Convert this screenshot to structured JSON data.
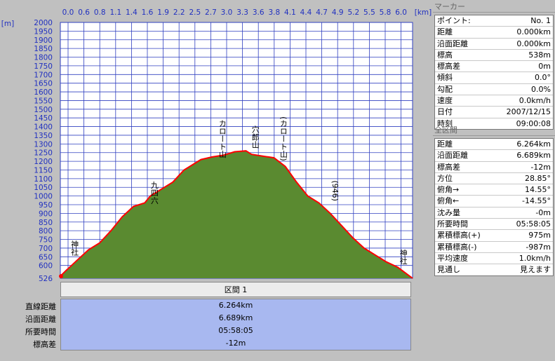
{
  "chart_data": {
    "type": "area",
    "x_unit": "[km]",
    "y_unit": "[m]",
    "x_ticks": [
      "0.0",
      "0.6",
      "0.8",
      "1.1",
      "1.4",
      "1.6",
      "1.9",
      "2.2",
      "2.5",
      "2.7",
      "3.0",
      "3.3",
      "3.6",
      "3.8",
      "4.1",
      "4.4",
      "4.7",
      "4.9",
      "5.2",
      "5.5",
      "5.8",
      "6.0"
    ],
    "y_ticks": [
      "2000",
      "1950",
      "1900",
      "1850",
      "1800",
      "1750",
      "1700",
      "1650",
      "1600",
      "1550",
      "1500",
      "1450",
      "1400",
      "1350",
      "1300",
      "1250",
      "1200",
      "1150",
      "1100",
      "1050",
      "1000",
      "950",
      "900",
      "850",
      "800",
      "750",
      "700",
      "650",
      "600"
    ],
    "y_min_label": "526",
    "xlim": [
      0,
      6.264
    ],
    "ylim": [
      526,
      2000
    ],
    "x": [
      0,
      0.1,
      0.2,
      0.3,
      0.5,
      0.7,
      0.9,
      1.1,
      1.3,
      1.5,
      1.6,
      1.8,
      2.0,
      2.2,
      2.4,
      2.5,
      2.7,
      2.9,
      3.1,
      3.3,
      3.4,
      3.6,
      3.8,
      4.0,
      4.2,
      4.4,
      4.6,
      4.8,
      5.0,
      5.2,
      5.4,
      5.6,
      5.8,
      6.0,
      6.264
    ],
    "y": [
      538,
      570,
      600,
      630,
      690,
      730,
      800,
      880,
      940,
      960,
      1000,
      1040,
      1080,
      1150,
      1190,
      1210,
      1225,
      1235,
      1255,
      1260,
      1240,
      1230,
      1220,
      1170,
      1080,
      1000,
      960,
      900,
      830,
      760,
      700,
      660,
      620,
      590,
      526
    ],
    "annotations": [
      {
        "text": "神社",
        "x": 0.3,
        "y": 700
      },
      {
        "text": "九四六",
        "x": 2.0,
        "y": 1020
      },
      {
        "text": "カロート山",
        "x": 3.45,
        "y": 1330
      },
      {
        "text": "穴郎山",
        "x": 4.15,
        "y": 1340
      },
      {
        "text": "(カロート山)",
        "x": 4.75,
        "y": 1330
      },
      {
        "text": "(946)",
        "x": 5.85,
        "y": 1030
      },
      {
        "text": "神社",
        "x": 7.3,
        "y": 650
      }
    ],
    "fill_color": "#5a8a30",
    "line_color": "#ff0000",
    "grid": true
  },
  "sections": {
    "header": "区間 1",
    "rows": [
      {
        "label": "直線距離",
        "value": "6.264km"
      },
      {
        "label": "沿面距離",
        "value": "6.689km"
      },
      {
        "label": "所要時間",
        "value": "05:58:05"
      },
      {
        "label": "標高差",
        "value": "-12m"
      }
    ]
  },
  "marker_panel": {
    "title": "マーカー",
    "rows": [
      {
        "k": "ポイント:",
        "v": "No. 1"
      },
      {
        "k": "距離",
        "v": "0.000km"
      },
      {
        "k": "沿面距離",
        "v": "0.000km"
      },
      {
        "k": "標高",
        "v": "538m"
      },
      {
        "k": "標高差",
        "v": "0m"
      },
      {
        "k": "傾斜",
        "v": "0.0°"
      },
      {
        "k": "勾配",
        "v": "0.0%"
      },
      {
        "k": "速度",
        "v": "0.0km/h"
      },
      {
        "k": "日付",
        "v": "2007/12/15"
      },
      {
        "k": "時刻",
        "v": "09:00:08"
      }
    ]
  },
  "total_panel": {
    "title": "全区間",
    "rows": [
      {
        "k": "距離",
        "v": "6.264km"
      },
      {
        "k": "沿面距離",
        "v": "6.689km"
      },
      {
        "k": "標高差",
        "v": "-12m"
      },
      {
        "k": "方位",
        "v": "28.85°"
      },
      {
        "k": "俯角→",
        "v": "14.55°"
      },
      {
        "k": "俯角←",
        "v": "-14.55°"
      },
      {
        "k": "沈み量",
        "v": "-0m"
      },
      {
        "k": "所要時間",
        "v": "05:58:05"
      },
      {
        "k": "累積標高(+)",
        "v": "975m"
      },
      {
        "k": "累積標高(-)",
        "v": "-987m"
      },
      {
        "k": "平均速度",
        "v": "1.0km/h"
      },
      {
        "k": "見通し",
        "v": "見えます"
      }
    ]
  }
}
